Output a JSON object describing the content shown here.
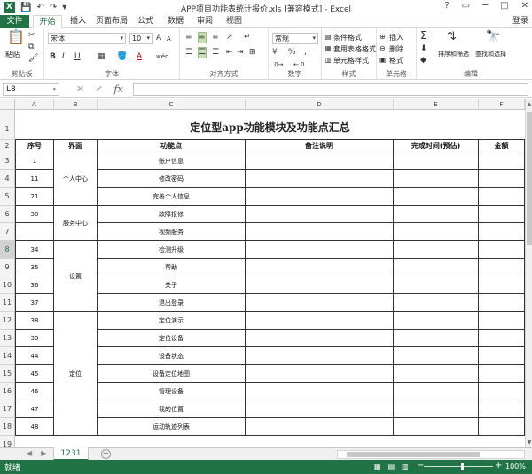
{
  "window": {
    "title": "APP项目功能表统计报价.xls [兼容模式] - Excel",
    "app_icon": "X",
    "controls": [
      "?",
      "▭",
      "─",
      "□",
      "✕"
    ]
  },
  "tabs": [
    {
      "label": "文件"
    },
    {
      "label": "开始"
    },
    {
      "label": "插入"
    },
    {
      "label": "页面布局"
    },
    {
      "label": "公式"
    },
    {
      "label": "数据"
    },
    {
      "label": "审阅"
    },
    {
      "label": "视图"
    }
  ],
  "login": "登录",
  "ribbon": {
    "clipboard": {
      "label": "剪贴板",
      "paste": "粘贴"
    },
    "font": {
      "label": "字体",
      "name": "宋体",
      "size": "10",
      "bold": "B",
      "italic": "I",
      "underline": "U",
      "grow": "A",
      "shrink": "A",
      "wen": "wén"
    },
    "alignment": {
      "label": "对齐方式"
    },
    "number": {
      "label": "数字",
      "format": "常规",
      "percent": "%",
      "comma": ","
    },
    "styles": {
      "label": "样式",
      "conditional": "条件格式",
      "table": "套用表格格式",
      "cell": "单元格样式"
    },
    "cells": {
      "label": "单元格",
      "insert": "插入",
      "delete": "删除",
      "format": "格式"
    },
    "editing": {
      "label": "编辑",
      "sum": "Σ",
      "sort": "排序和筛选",
      "find": "查找和选择"
    }
  },
  "formula_bar": {
    "name_box": "L8",
    "fx": "fx",
    "value": ""
  },
  "columns": [
    "A",
    "B",
    "C",
    "D",
    "E",
    "F"
  ],
  "sheet": {
    "title": "定位型app功能模块及功能点汇总",
    "headers": [
      "序号",
      "界面",
      "功能点",
      "备注说明",
      "完成时间(预估)",
      "金额"
    ],
    "row_numbers": [
      "1",
      "2",
      "3",
      "4",
      "5",
      "6",
      "7",
      "8",
      "9",
      "10",
      "11",
      "12",
      "13",
      "14",
      "15",
      "16",
      "17",
      "18",
      "19"
    ],
    "rows": [
      {
        "no": "1",
        "feature": "账户信息"
      },
      {
        "no": "11",
        "feature": "修改密码"
      },
      {
        "no": "21",
        "feature": "完善个人信息"
      },
      {
        "no": "30",
        "feature": "故障报修"
      },
      {
        "no": "",
        "feature": "视频服务"
      },
      {
        "no": "34",
        "feature": "检测升级"
      },
      {
        "no": "35",
        "feature": "帮助"
      },
      {
        "no": "36",
        "feature": "关于"
      },
      {
        "no": "37",
        "feature": "退出登录"
      },
      {
        "no": "38",
        "feature": "定位演示"
      },
      {
        "no": "39",
        "feature": "定位设备"
      },
      {
        "no": "44",
        "feature": "设备状态"
      },
      {
        "no": "45",
        "feature": "设备定位地图"
      },
      {
        "no": "46",
        "feature": "管理设备"
      },
      {
        "no": "47",
        "feature": "我的位置"
      },
      {
        "no": "48",
        "feature": "运动轨迹列表"
      }
    ],
    "groups": [
      {
        "label": "个人中心"
      },
      {
        "label": "服务中心"
      },
      {
        "label": "设置"
      },
      {
        "label": "定位"
      }
    ]
  },
  "sheet_tab": "1231",
  "status": {
    "ready": "就绪",
    "zoom": "100%"
  }
}
